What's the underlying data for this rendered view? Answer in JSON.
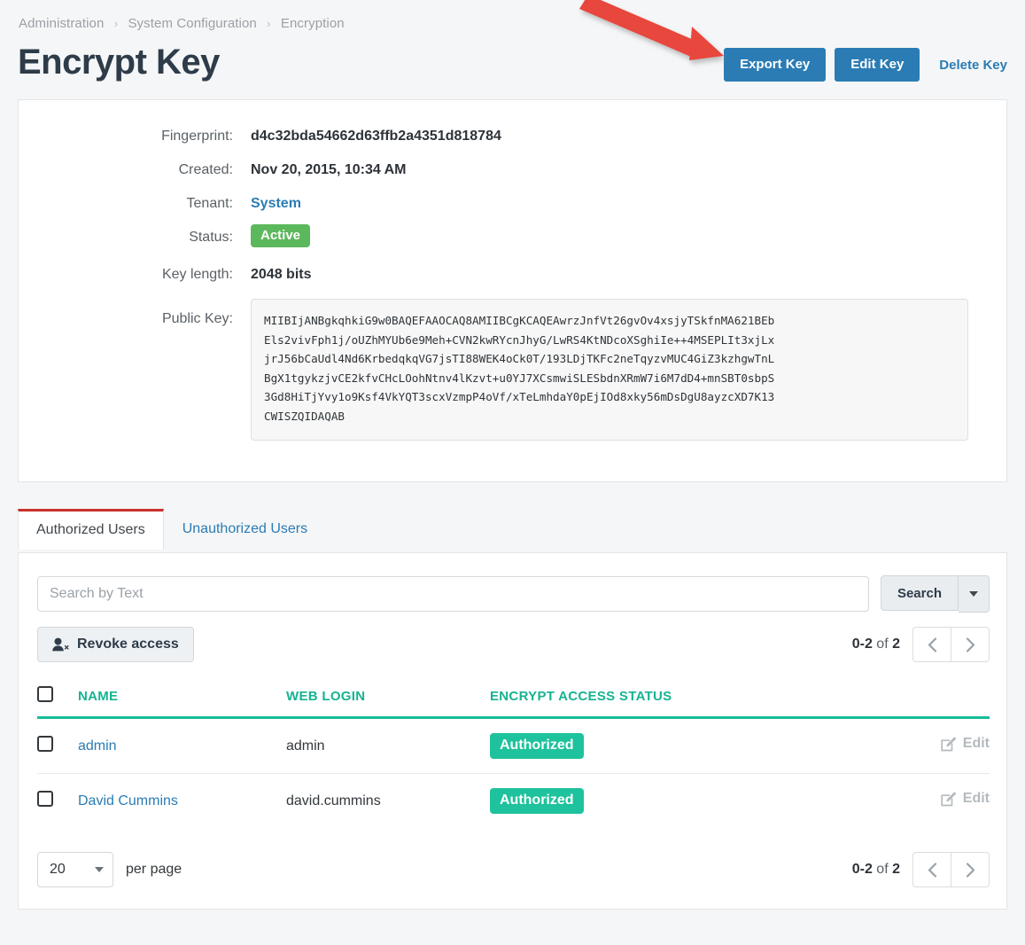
{
  "breadcrumb": {
    "items": [
      "Administration",
      "System Configuration",
      "Encryption"
    ],
    "separator": "›"
  },
  "page": {
    "title": "Encrypt Key"
  },
  "header_actions": {
    "export_label": "Export Key",
    "edit_label": "Edit Key",
    "delete_label": "Delete Key"
  },
  "details": {
    "fingerprint_label": "Fingerprint:",
    "fingerprint_value": "d4c32bda54662d63ffb2a4351d818784",
    "created_label": "Created:",
    "created_value": "Nov 20, 2015, 10:34 AM",
    "tenant_label": "Tenant:",
    "tenant_value": "System",
    "status_label": "Status:",
    "status_value": "Active",
    "keylength_label": "Key length:",
    "keylength_value": "2048 bits",
    "publickey_label": "Public Key:",
    "publickey_value": "MIIBIjANBgkqhkiG9w0BAQEFAAOCAQ8AMIIBCgKCAQEAwrzJnfVt26gvOv4xsjyTSkfnMA621BEb\nEls2vivFph1j/oUZhMYUb6e9Meh+CVN2kwRYcnJhyG/LwRS4KtNDcoXSghiIe++4MSEPLIt3xjLx\njrJ56bCaUdl4Nd6KrbedqkqVG7jsTI88WEK4oCk0T/193LDjTKFc2neTqyzvMUC4GiZ3kzhgwTnL\nBgX1tgykzjvCE2kfvCHcLOohNtnv4lKzvt+u0YJ7XCsmwiSLESbdnXRmW7i6M7dD4+mnSBT0sbpS\n3Gd8HiTjYvy1o9Ksf4VkYQT3scxVzmpP4oVf/xTeLmhdaY0pEjIOd8xky56mDsDgU8ayzcXD7K13\nCWISZQIDAQAB"
  },
  "tabs": [
    {
      "label": "Authorized Users",
      "active": true
    },
    {
      "label": "Unauthorized Users",
      "active": false
    }
  ],
  "toolbar": {
    "search_placeholder": "Search by Text",
    "search_value": "",
    "search_button": "Search",
    "revoke_label": "Revoke access"
  },
  "pagination_top": {
    "range": "0-2",
    "of": "of",
    "total": "2"
  },
  "pagination_bottom": {
    "range": "0-2",
    "of": "of",
    "total": "2"
  },
  "table": {
    "columns": [
      "NAME",
      "WEB LOGIN",
      "ENCRYPT ACCESS STATUS"
    ],
    "rows": [
      {
        "name": "admin",
        "web_login": "admin",
        "status": "Authorized",
        "edit_label": "Edit"
      },
      {
        "name": "David Cummins",
        "web_login": "david.cummins",
        "status": "Authorized",
        "edit_label": "Edit"
      }
    ]
  },
  "footer": {
    "per_page_value": "20",
    "per_page_label": "per page"
  },
  "colors": {
    "primary_blue": "#2b7cb4",
    "link_blue": "#2b7cb4",
    "status_green": "#5cb85c",
    "badge_teal": "#1ec29c",
    "table_header_teal": "#16b391",
    "tab_accent_red": "#c9302c",
    "annotation_red": "#e8463c",
    "page_bg": "#f5f6f7"
  }
}
